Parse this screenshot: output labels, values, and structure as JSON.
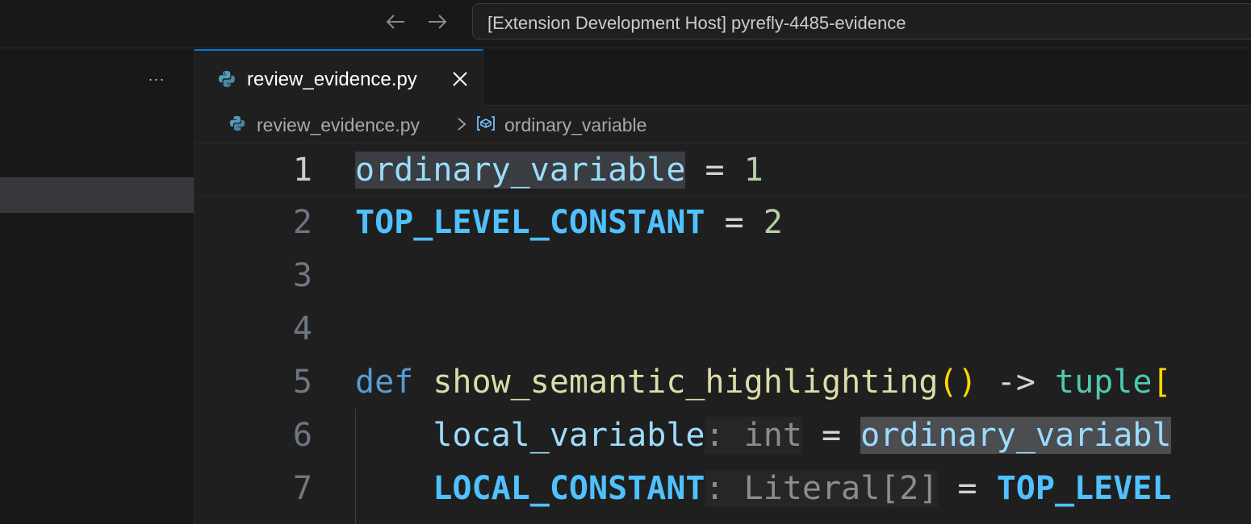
{
  "window": {
    "title": "[Extension Development Host] pyrefly-4485-evidence"
  },
  "sidebar": {
    "more_actions": "···"
  },
  "tabs": [
    {
      "label": "review_evidence.py",
      "icon": "python-file-icon",
      "active": true
    }
  ],
  "breadcrumb": {
    "file": "review_evidence.py",
    "symbol": "ordinary_variable"
  },
  "editor": {
    "lines": [
      {
        "number": "1",
        "tokens": [
          {
            "text": "ordinary_variable",
            "kind": "var-hl"
          },
          {
            "text": " = ",
            "kind": "op"
          },
          {
            "text": "1",
            "kind": "num"
          }
        ]
      },
      {
        "number": "2",
        "tokens": [
          {
            "text": "TOP_LEVEL_CONSTANT",
            "kind": "const"
          },
          {
            "text": " = ",
            "kind": "op"
          },
          {
            "text": "2",
            "kind": "num"
          }
        ]
      },
      {
        "number": "3",
        "tokens": []
      },
      {
        "number": "4",
        "tokens": []
      },
      {
        "number": "5",
        "tokens": [
          {
            "text": "def",
            "kind": "kw"
          },
          {
            "text": " ",
            "kind": "op"
          },
          {
            "text": "show_semantic_highlighting",
            "kind": "fn"
          },
          {
            "text": "()",
            "kind": "br"
          },
          {
            "text": " -> ",
            "kind": "op"
          },
          {
            "text": "tuple",
            "kind": "type"
          },
          {
            "text": "[",
            "kind": "br"
          }
        ]
      },
      {
        "number": "6",
        "tokens": [
          {
            "text": "    ",
            "kind": "op"
          },
          {
            "text": "local_variable",
            "kind": "var"
          },
          {
            "text": ": int",
            "kind": "hint"
          },
          {
            "text": " = ",
            "kind": "op"
          },
          {
            "text": "ordinary_variabl",
            "kind": "var-hl2"
          }
        ]
      },
      {
        "number": "7",
        "tokens": [
          {
            "text": "    ",
            "kind": "op"
          },
          {
            "text": "LOCAL_CONSTANT",
            "kind": "const"
          },
          {
            "text": ": Literal[2]",
            "kind": "hint"
          },
          {
            "text": " = ",
            "kind": "op"
          },
          {
            "text": "TOP_LEVEL",
            "kind": "const"
          }
        ]
      }
    ],
    "active_line": "1"
  }
}
